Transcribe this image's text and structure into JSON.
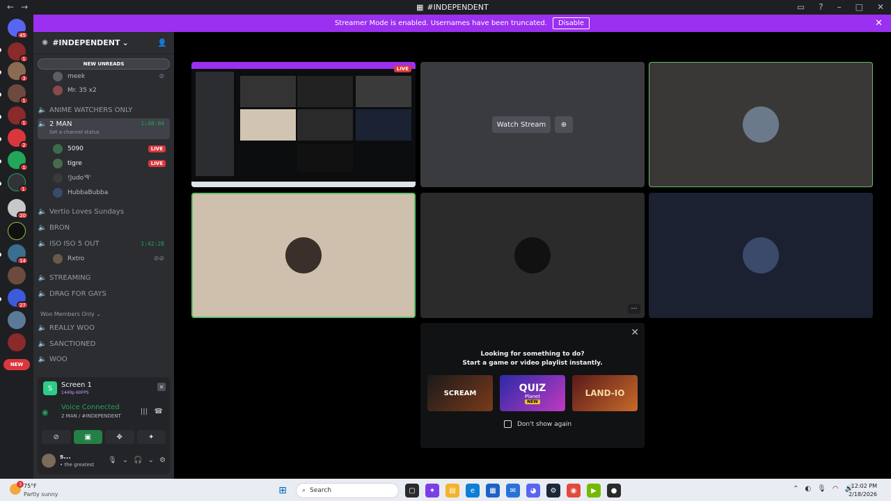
{
  "window": {
    "title": "#INDEPENDENT",
    "back": "←",
    "forward": "→"
  },
  "banner": {
    "text": "Streamer Mode is enabled. Usernames have been truncated.",
    "disable_label": "Disable"
  },
  "servers": {
    "badges": [
      "45",
      "1",
      "3",
      "1",
      "1",
      "2",
      "1",
      "1",
      "20",
      "14",
      "27"
    ],
    "new_label": "NEW"
  },
  "channel_header": {
    "name": "#INDEPENDENT"
  },
  "new_unreads": "NEW UNREADS",
  "channels": {
    "pre_users": [
      "meek",
      "Mr. 35 x2"
    ],
    "anime": "ANIME WATCHERS ONLY",
    "two_man": {
      "name": "2 MAN",
      "time": "1:48:04",
      "status": "Set a channel status"
    },
    "two_man_users": [
      {
        "name": "5090",
        "live": "LIVE"
      },
      {
        "name": "tigre",
        "live": "LIVE"
      },
      {
        "name": "!Judo'ꟼ'",
        "live": ""
      },
      {
        "name": "HubbaBubba",
        "live": ""
      }
    ],
    "vertio": "Vertio Loves Sundays",
    "bron": "BRON",
    "iso": {
      "name": "ISO ISO 5 OUT",
      "time": "1:42:28"
    },
    "iso_users": [
      "Rxtro"
    ],
    "streaming": "STREAMING",
    "drag": "DRAG FOR GAYS",
    "category": "Woo Members Only",
    "really_woo": "REALLY WOO",
    "sanctioned": "SANCTIONED",
    "woo": "WOO"
  },
  "panel": {
    "screen_name": "Screen 1",
    "screen_quality": "1440p 60FPS",
    "voice_status": "Voice Connected",
    "voice_channel": "2 MAN / #INDEPENDENT",
    "user_name": "s...",
    "user_status": "• the greatest"
  },
  "stage": {
    "live_label": "LIVE",
    "watch_label": "Watch Stream",
    "activity_line1": "Looking for something to do?",
    "activity_line2": "Start a game or video playlist instantly.",
    "games": [
      "SCREAM",
      "QUIZ",
      "LAND-IO"
    ],
    "quiz_sub": "Planet",
    "quiz_new": "NEW",
    "dont_show": "Don't show again"
  },
  "taskbar": {
    "temp": "75°F",
    "weather": "Partly sunny",
    "weather_badge": "3",
    "search": "Search",
    "time": "12:02 PM",
    "date": "2/18/2026"
  },
  "colors": {
    "accent": "#9b30f0",
    "green": "#23a55a",
    "red": "#da373c"
  }
}
